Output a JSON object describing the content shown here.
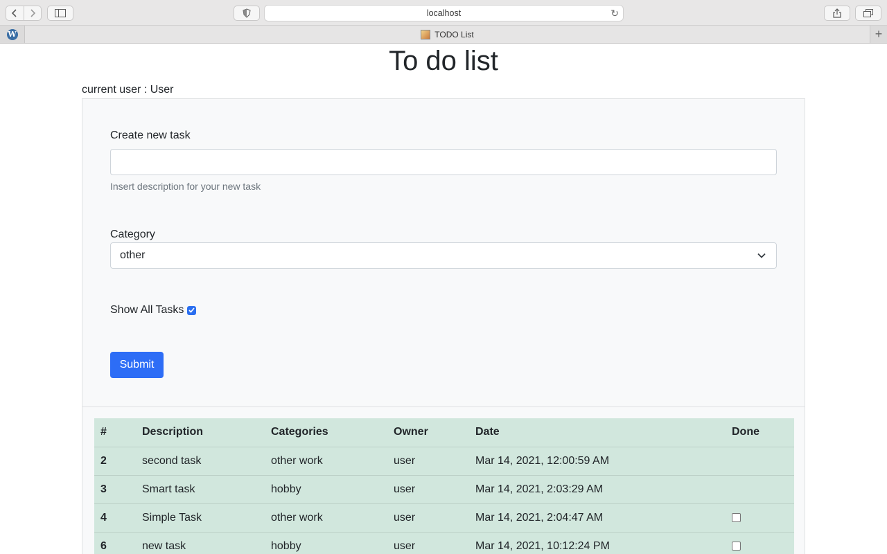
{
  "browser": {
    "address": "localhost",
    "tab_title": "TODO List",
    "new_tab_symbol": "+"
  },
  "page": {
    "title": "To do list",
    "current_user": "current user : User"
  },
  "form": {
    "task_label": "Create new task",
    "task_value": "",
    "task_help": "Insert description for your new task",
    "category_label": "Category",
    "category_selected": "other",
    "show_all_label": "Show All Tasks",
    "show_all_checked": true,
    "submit_label": "Submit"
  },
  "table": {
    "headers": [
      "#",
      "Description",
      "Categories",
      "Owner",
      "Date",
      "Done"
    ],
    "rows": [
      {
        "id": "2",
        "description": "second task",
        "category": "other work",
        "owner": "user",
        "date": "Mar 14, 2021, 12:00:59 AM",
        "done_checkbox": false
      },
      {
        "id": "3",
        "description": "Smart task",
        "category": "hobby",
        "owner": "user",
        "date": "Mar 14, 2021, 2:03:29 AM",
        "done_checkbox": false
      },
      {
        "id": "4",
        "description": "Simple Task",
        "category": "other work",
        "owner": "user",
        "date": "Mar 14, 2021, 2:04:47 AM",
        "done_checkbox": true
      },
      {
        "id": "6",
        "description": "new task",
        "category": "hobby",
        "owner": "user",
        "date": "Mar 14, 2021, 10:12:24 PM",
        "done_checkbox": true
      }
    ]
  },
  "colors": {
    "primary": "#2d6df6",
    "table_bg": "#d1e7dd",
    "card_bg": "#f8f9fa"
  }
}
